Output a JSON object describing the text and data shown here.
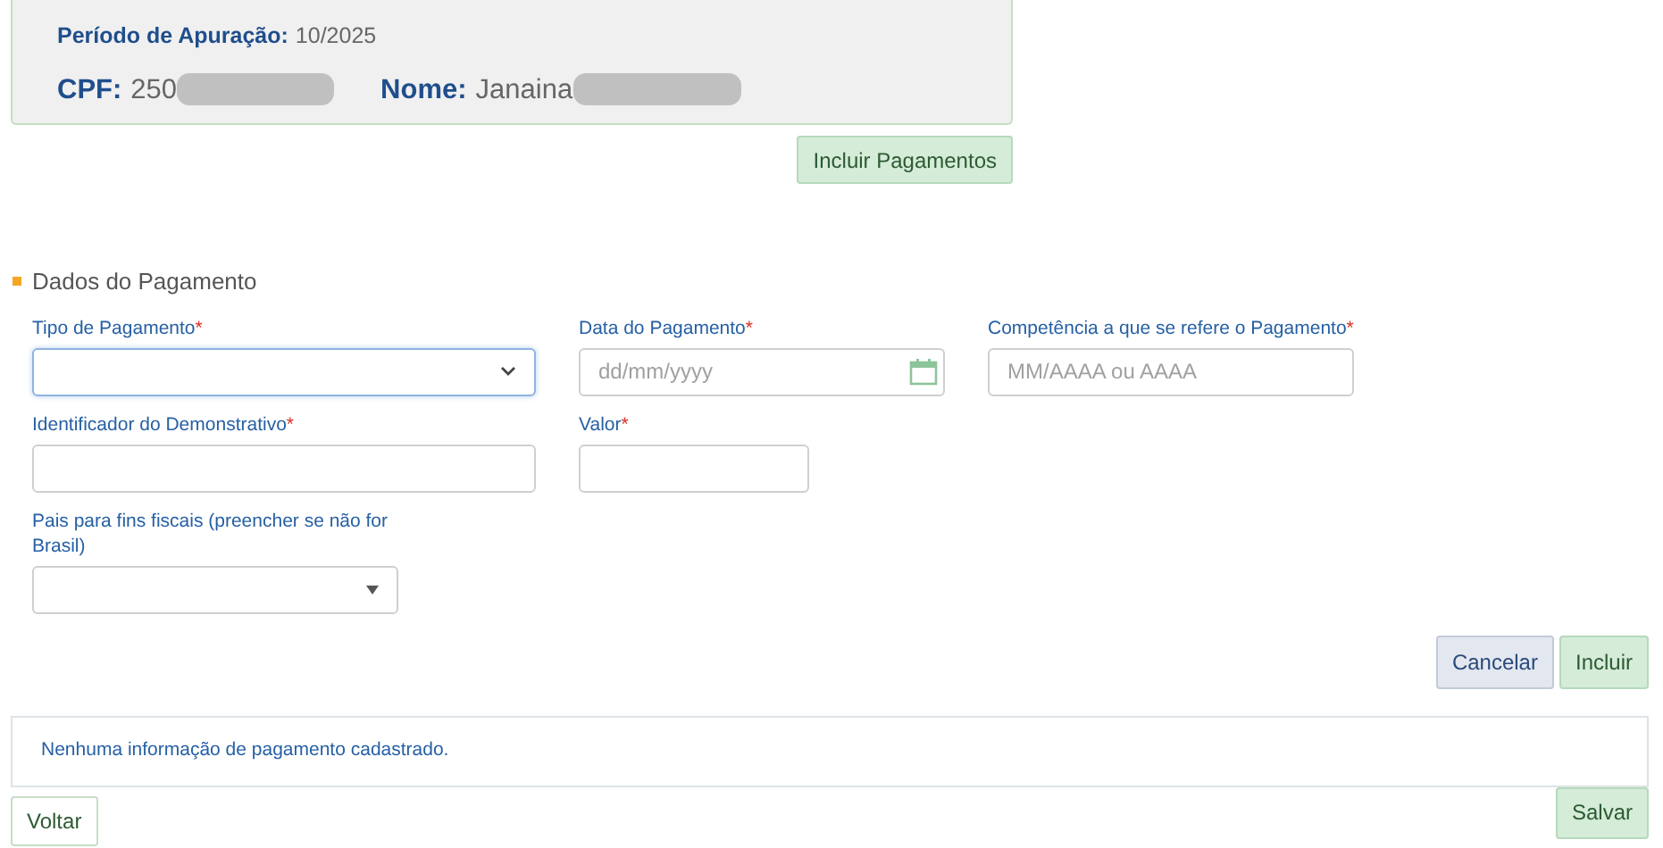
{
  "header": {
    "period_label": "Período de Apuração:",
    "period_value": "10/2025",
    "cpf_label": "CPF:",
    "cpf_value": "250",
    "name_label": "Nome:",
    "name_value": "Janaina"
  },
  "add_payments_button": "Incluir Pagamentos",
  "section": {
    "title": "Dados do Pagamento"
  },
  "field_rows": [
    [
      {
        "kind": "select",
        "label": "Tipo de Pagamento",
        "required_mark": "*",
        "focused": true
      },
      {
        "kind": "date",
        "label": "Data do Pagamento",
        "required_mark": "*",
        "placeholder": "dd/mm/yyyy"
      },
      {
        "kind": "text",
        "label": "Competência a que se refere o Pagamento",
        "required_mark": "*",
        "placeholder": "MM/AAAA ou AAAA"
      }
    ],
    [
      {
        "kind": "text",
        "label": "Identificador do Demonstrativo",
        "required_mark": "*"
      },
      {
        "kind": "text",
        "label": "Valor",
        "required_mark": "*"
      }
    ],
    [
      {
        "kind": "combo",
        "label": "Pais para fins fiscais (preencher se não for Brasil)"
      }
    ]
  ],
  "form_buttons": [
    {
      "label": "Cancelar",
      "kind": "secondary"
    },
    {
      "label": "Incluir",
      "kind": "primary"
    }
  ],
  "empty_message": "Nenhuma informação de pagamento cadastrado.",
  "back_button": "Voltar",
  "save_button": "Salvar"
}
